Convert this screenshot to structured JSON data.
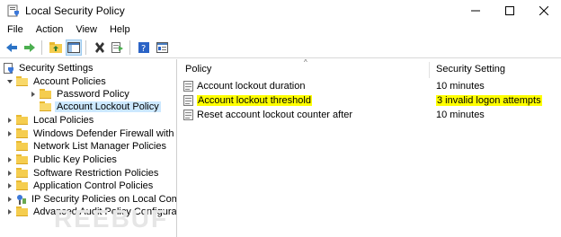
{
  "window": {
    "title": "Local Security Policy"
  },
  "menu": [
    "File",
    "Action",
    "View",
    "Help"
  ],
  "tree": {
    "root": "Security Settings",
    "items": [
      {
        "label": "Account Policies"
      },
      {
        "label": "Password Policy"
      },
      {
        "label": "Account Lockout Policy"
      },
      {
        "label": "Local Policies"
      },
      {
        "label": "Windows Defender Firewall with Adva"
      },
      {
        "label": "Network List Manager Policies"
      },
      {
        "label": "Public Key Policies"
      },
      {
        "label": "Software Restriction Policies"
      },
      {
        "label": "Application Control Policies"
      },
      {
        "label": "IP Security Policies on Local Compute"
      },
      {
        "label": "Advanced Audit Policy Configuration"
      }
    ]
  },
  "list": {
    "columns": {
      "policy": "Policy",
      "setting": "Security Setting"
    },
    "rows": [
      {
        "policy": "Account lockout duration",
        "setting": "10 minutes",
        "highlighted": false
      },
      {
        "policy": "Account lockout threshold",
        "setting": "3 invalid logon attempts",
        "highlighted": true
      },
      {
        "policy": "Reset account lockout counter after",
        "setting": "10 minutes",
        "highlighted": false
      }
    ]
  },
  "colors": {
    "highlight": "#ffff00",
    "selection": "#cce8ff",
    "folder": "#f5cd4f"
  },
  "watermark": "REEBUF"
}
